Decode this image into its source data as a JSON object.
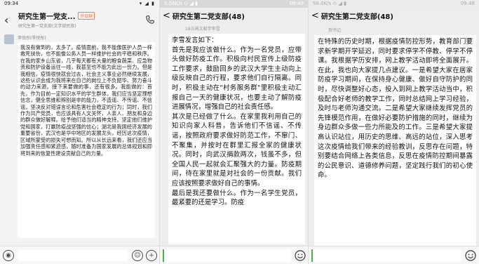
{
  "panel1": {
    "status_time": "09:34",
    "status_icons": "▾ ◢ ▮",
    "title": "研究生第一党支...",
    "badge": "外部群",
    "subtitle": "研究生第一党支部(文学部民族)",
    "sender": "李悦彤(李悦彤)",
    "message": "我没有做到的，太多了。疫情面前，我不能像医护人员一样救死扶伤，也不能像公务人员一样维护社会的平稳和秩序。在我的家乡山东省，几乎每天都有大量的粮食蔬菜、应急物资和防护设备运往一线，我甚至也不能为此出一份力。但是我相信，疫情很快就会过去，社会主义事业必然继续发展，这些认识会成为我将来在自己的岗位上不负韶华、努力奋斗的动力来源。接下来要做的事，还有很多。我能做的：首先，作为目前一定知识水平的学生群体，我们应当坚定理想信念，健全思维和辨别是非的能力，不造谣、不传谣、不信谣，坚决反对错误言论和危害社会稳定的行为；同时，我们作为共产党员，也应该具有人文关怀，人亲人、朋友和身边的群众做好解释。给予他们适当的精神支持。坚定他们维护党和国家，打赢防疫战坚强的信心；湖北是我国经济发展的重要省份，武汉也是华中地区的发展龙头，经历这次疫情，区域所蒙受的损失可想而知。所以从长远来看，我们还应当加强责任感和紧迫感，随时准备为国家发展的总体规划和即将到来的恢复性建设贡献自己的力量。",
    "input_icons": [
      "voice-icon",
      "emoji-icon",
      "plus-icon"
    ]
  },
  "panel2": {
    "status_time": "09:49",
    "status_info": "0.06K/s ⊙ ◢ ▮",
    "back": "<",
    "title": "研究生第二党支部(48)",
    "sender": "18古典文献学李雪",
    "message": "李雪发言如下：\n首先是我应该做什么。作为一名党员，应带头做好防疫工作。积极向村民宣传上级防疫工作要求，鼓励回乡的武汉大学生主动向上级反映自己的行程，要求他们自行隔离。同时，积极主动在\"村务服务群\"里积极主动汇报自己一天的健康状况，也要主动了解防疫进展情况，增强自己的社会责任感。\n其次是已经做了什么。在家里我利用自己的知识向家人科普，告诉他们不信谣、不传谣，按照政府要求做好防范工作，不窜门、不聚集，并按时在群里汇报全家的健康状况。同时，向武汉捐款两次，钱虽不多，但全国人民一起就会汇聚强大的力量。防疫期间，待在家里就是对社会的一份贡献。我们应该按照要求做好自己的事情。\n最后是我还要做什么。作为一名学生党员，最紧要的还是学习。防疫"
  },
  "panel3": {
    "status_time": "09:48",
    "status_info": "98.0K/s ⊙ ◢ ▮",
    "back": "<",
    "title": "研究生第二党支部(48)",
    "sender": "贺书记",
    "message": "在特殊的历史时期，根据疫情防控形势，教育部门要求新学期开学延迟，同时要求停学不停教、停学不停课。我根据学历安排，网上教学活动即将全面展开。在此，我也向大家提几点建议。一是希望大家在居家防疫学习期间，在保持身心健康、做好自守防护的同时，尽快调整好心态，投入到网上教学活动当中，积极配合好老师的教学工作，同时总结网上学习经验，及时与老师沟通交流。二是希望大家继续发挥党员的先锋模范作用，在做好必要防护措施的同时，继续为身边群众多做一些力所能及的工作。三是希望大家提高认识站位，用历史的思维、高远的站位，深入思考这次疫情给我们带来的经验教训，反思存在问题，特别要结合网络上各类信息，反思在疫情防控期间暴露的公民意识、道德修养问题，坚定践行我们的初心使命。"
  },
  "colors": {
    "accent_green": "#44b549",
    "badge_orange": "#ff7a45"
  }
}
